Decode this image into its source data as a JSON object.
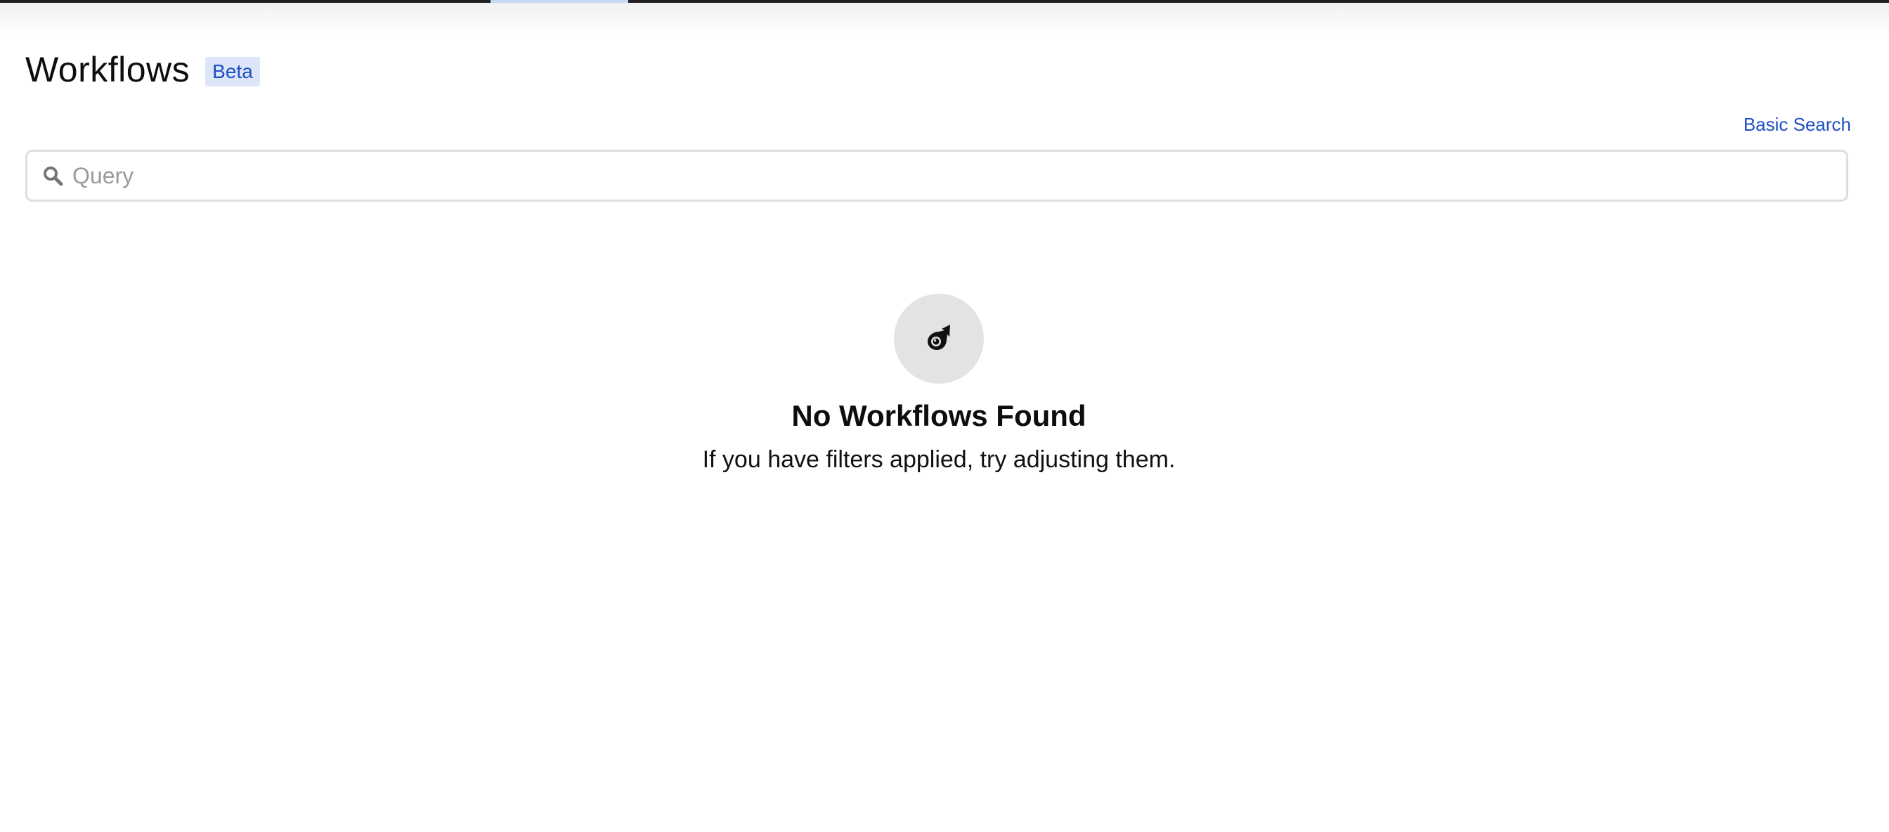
{
  "header": {
    "title": "Workflows",
    "badge": "Beta"
  },
  "search": {
    "mode_link_label": "Basic Search",
    "placeholder": "Query",
    "value": "",
    "icon": "search-icon"
  },
  "empty_state": {
    "icon": "comet-icon",
    "title": "No Workflows Found",
    "subtitle": "If you have filters applied, try adjusting them."
  },
  "colors": {
    "accent": "#1f4fc4",
    "badge_bg": "#dde6f8",
    "empty_icon_bg": "#e3e3e5",
    "search_border": "#dedede"
  }
}
